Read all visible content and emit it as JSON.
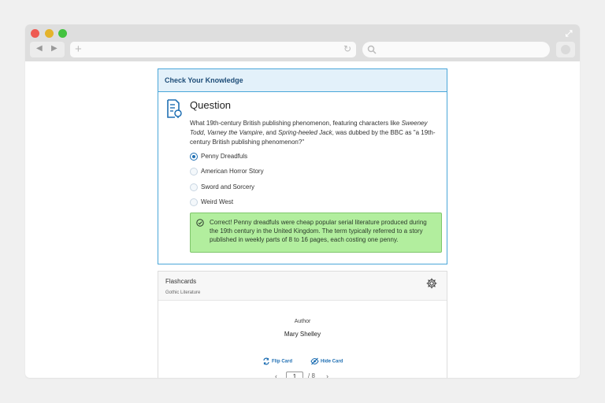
{
  "check": {
    "header": "Check Your Knowledge",
    "title": "Question",
    "question_parts": [
      "What 19th-century British publishing phenomenon, featuring characters like ",
      "Sweeney Todd",
      ", ",
      "Varney the Vampire",
      ", and ",
      "Spring-heeled Jack",
      ", was dubbed by the BBC as \"a 19th-century British publishing phenomenon?\""
    ],
    "options": [
      {
        "label": "Penny Dreadfuls",
        "selected": true
      },
      {
        "label": "American Horror Story",
        "selected": false
      },
      {
        "label": "Sword and Sorcery",
        "selected": false
      },
      {
        "label": "Weird West",
        "selected": false
      }
    ],
    "feedback": "Correct! Penny dreadfuls were cheap popular serial literature produced during the 19th century in the United Kingdom. The term typically referred to a story published in weekly parts of 8 to 16 pages, each costing one penny."
  },
  "flashcards": {
    "title": "Flashcards",
    "subtitle": "Gothic Literature",
    "term_label": "Author",
    "term": "Mary Shelley",
    "flip_label": "Flip Card",
    "hide_label": "Hide Card",
    "page_current": "1",
    "page_total": "/ 8"
  },
  "colors": {
    "accent": "#4aa6d9",
    "header_bg": "#e3f1fa",
    "correct_bg": "#b2ee9e",
    "link": "#1f6fb3"
  },
  "icons": {
    "question": "question-doc-icon",
    "settings": "gear-icon",
    "flip": "flip-icon",
    "hide": "eye-off-icon",
    "check": "check-circle-icon"
  }
}
